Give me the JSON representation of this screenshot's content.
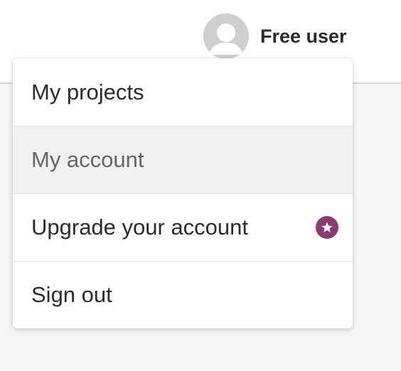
{
  "header": {
    "user_name": "Free user",
    "avatar_icon": "user-avatar-icon"
  },
  "menu": {
    "items": [
      {
        "label": "My projects",
        "state": "normal"
      },
      {
        "label": "My account",
        "state": "hovered"
      },
      {
        "label": "Upgrade your account",
        "state": "normal",
        "badge_icon": "star-icon"
      },
      {
        "label": "Sign out",
        "state": "normal"
      }
    ]
  },
  "colors": {
    "badge": "#8c3c6c",
    "hover_background": "#f1f1f1",
    "avatar": "#cfcfcf"
  }
}
